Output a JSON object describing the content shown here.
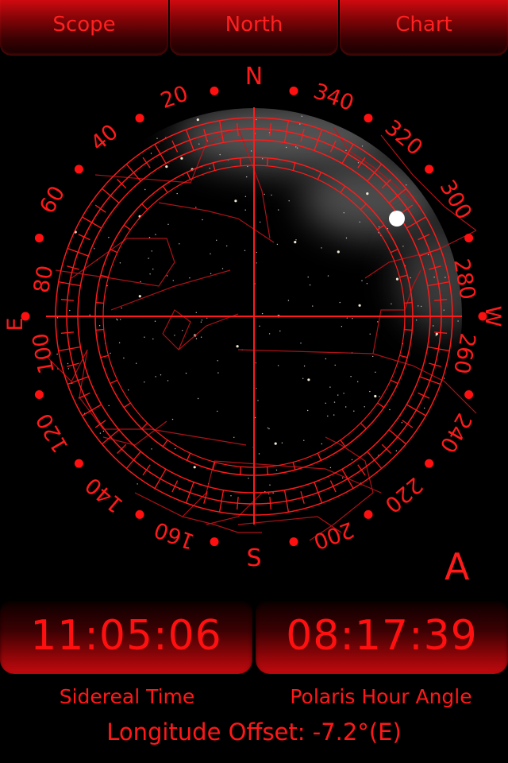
{
  "tabs": [
    {
      "label": "Scope"
    },
    {
      "label": "North"
    },
    {
      "label": "Chart"
    }
  ],
  "dial": {
    "cardinals": {
      "north": "N",
      "south": "S",
      "east": "E",
      "west": "W"
    },
    "degree_labels": [
      "20",
      "40",
      "60",
      "80",
      "100",
      "120",
      "140",
      "160",
      "200",
      "220",
      "240",
      "260",
      "280",
      "300",
      "320",
      "340"
    ]
  },
  "mode_letter": "A",
  "clocks": {
    "sidereal_time": "11:05:06",
    "polaris_hour_angle": "08:17:39"
  },
  "captions": {
    "sidereal_time": "Sidereal Time",
    "polaris_hour_angle": "Polaris Hour Angle"
  },
  "longitude_offset": "Longitude Offset: -7.2°(E)",
  "colors": {
    "accent": "#e8101c",
    "background": "#000000",
    "polaris_marker": "#ffffff"
  }
}
